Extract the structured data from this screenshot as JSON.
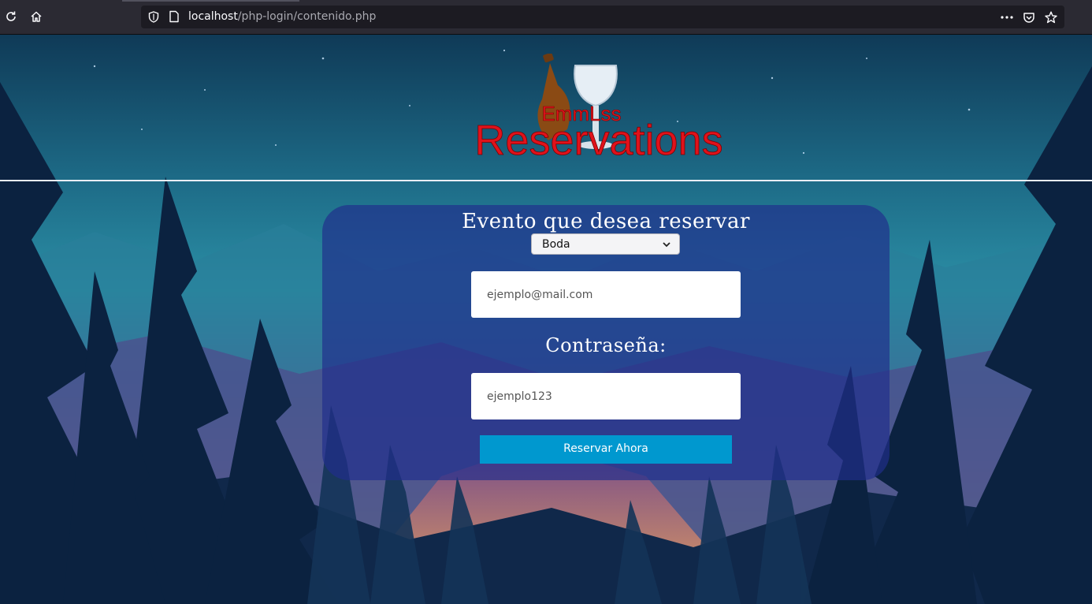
{
  "browser": {
    "url_host": "localhost",
    "url_path": "/php-login/contenido.php",
    "icons": {
      "reload": "reload-icon",
      "home": "home-icon",
      "shield": "shield-icon",
      "page": "page-icon",
      "more": "more-icon",
      "pocket": "pocket-icon",
      "bookmark": "star-icon"
    }
  },
  "logo": {
    "top_text": "EmmLss",
    "main_text": "Reservations",
    "color": "#e0121b"
  },
  "form": {
    "title": "Evento que desea reservar",
    "event_select": {
      "selected": "Boda"
    },
    "email_placeholder": "ejemplo@mail.com",
    "password_label": "Contraseña:",
    "password_placeholder": "ejemplo123",
    "submit_label": "Reservar Ahora",
    "accent_color": "#0098cf"
  }
}
